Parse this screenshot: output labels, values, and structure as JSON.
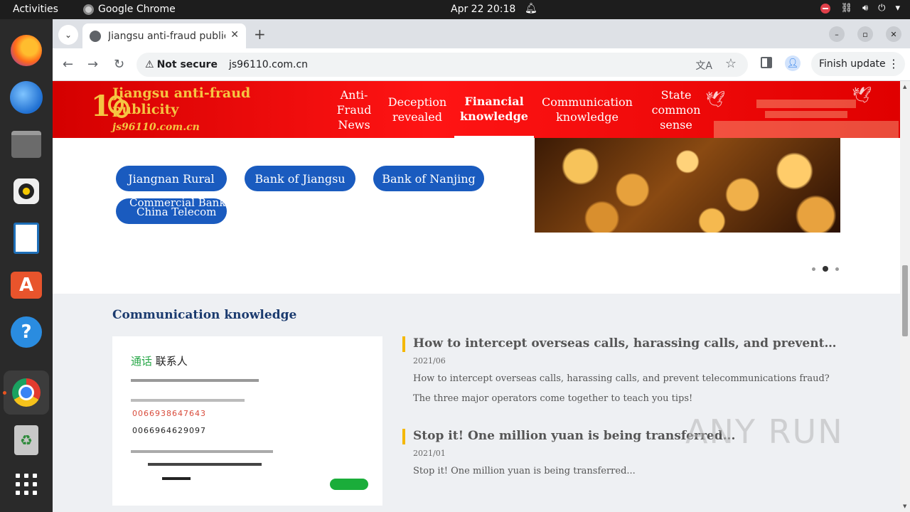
{
  "topbar": {
    "activities": "Activities",
    "app_name": "Google Chrome",
    "clock": "Apr 22  20:18"
  },
  "dock": {
    "items": [
      "firefox-icon",
      "thunderbird-icon",
      "files-icon",
      "rhythmbox-icon",
      "writer-icon",
      "software-icon",
      "help-icon",
      "chrome-icon",
      "trash-icon",
      "apps-grid-icon"
    ]
  },
  "browser": {
    "tab_title": "Jiangsu anti-fraud publicity",
    "security_label": "Not secure",
    "url": "js96110.com.cn",
    "finish_update": "Finish update"
  },
  "site": {
    "title": "Jiangsu anti-fraud publicity",
    "domain": "js96110.com.cn",
    "nav": [
      "Anti-Fraud News",
      "Deception revealed",
      "Financial knowledge",
      "Communication knowledge",
      "State common sense"
    ],
    "active_nav_index": 2
  },
  "banks": {
    "buttons": [
      "Jiangnan Rural",
      "Bank of Jiangsu",
      "Bank of Nanjing"
    ],
    "overlap_line1": "Commercial Bank",
    "overlap_line2": "China Telecom"
  },
  "carousel": {
    "slides": 3,
    "active": 1
  },
  "comm_section": {
    "title": "Communication knowledge",
    "screenshot": {
      "header_green": "通话",
      "header_black": "联系人",
      "red_number": "0066938647643",
      "black_number": "0066964629097"
    },
    "articles": [
      {
        "title": "How to intercept overseas calls, harassing calls, and prevent telecommunications fraud? The three major operators come together to teach you tips!",
        "date": "2021/06",
        "desc": "How to intercept overseas calls, harassing calls, and prevent telecommunications fraud? The three major operators come together to teach you tips!"
      },
      {
        "title": "Stop it! One million yuan is being transferred...",
        "date": "2021/01",
        "desc": "Stop it! One million yuan is being transferred..."
      }
    ]
  },
  "watermark": "ANY RUN"
}
